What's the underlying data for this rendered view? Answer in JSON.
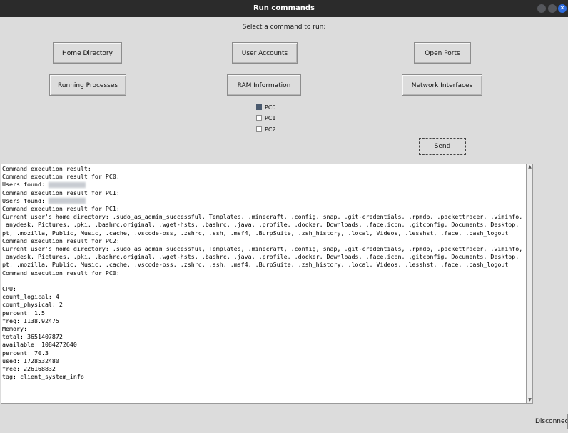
{
  "window": {
    "title": "Run commands"
  },
  "prompt": "Select a command to run:",
  "commands": [
    "Home Directory",
    "User Accounts",
    "Open Ports",
    "Running Processes",
    "RAM Information",
    "Network Interfaces"
  ],
  "targets": [
    {
      "label": "PC0",
      "checked": true
    },
    {
      "label": "PC1",
      "checked": false
    },
    {
      "label": "PC2",
      "checked": false
    }
  ],
  "send_label": "Send",
  "output_lines": [
    "Command execution result:",
    "Command execution result for PC0:",
    "Users found: [blurred]",
    "Command execution result for PC1:",
    "Users found: [blurred]",
    "Command execution result for PC1:",
    "Current user's home directory: .sudo_as_admin_successful, Templates, .minecraft, .config, snap, .git-credentials, .rpmdb, .packettracer, .viminfo, .anydesk, Pictures, .pki, .bashrc.original, .wget-hsts, .bashrc, .java, .profile, .docker, Downloads, .face.icon, .gitconfig, Documents, Desktop, pt, .mozilla, Public, Music, .cache, .vscode-oss, .zshrc, .ssh, .msf4, .BurpSuite, .zsh_history, .local, Videos, .lesshst, .face, .bash_logout",
    "Command execution result for PC2:",
    "Current user's home directory: .sudo_as_admin_successful, Templates, .minecraft, .config, snap, .git-credentials, .rpmdb, .packettracer, .viminfo, .anydesk, Pictures, .pki, .bashrc.original, .wget-hsts, .bashrc, .java, .profile, .docker, Downloads, .face.icon, .gitconfig, Documents, Desktop, pt, .mozilla, Public, Music, .cache, .vscode-oss, .zshrc, .ssh, .msf4, .BurpSuite, .zsh_history, .local, Videos, .lesshst, .face, .bash_logout",
    "Command execution result for PC0:",
    "",
    "CPU:",
    "count_logical: 4",
    "count_physical: 2",
    "percent: 1.5",
    "freq: 1138.92475",
    "Memory:",
    "total: 3651407872",
    "available: 1084272640",
    "percent: 70.3",
    "used: 1728532480",
    "free: 226168832",
    "tag: client_system_info"
  ],
  "disconnect_label": "Disconnect"
}
